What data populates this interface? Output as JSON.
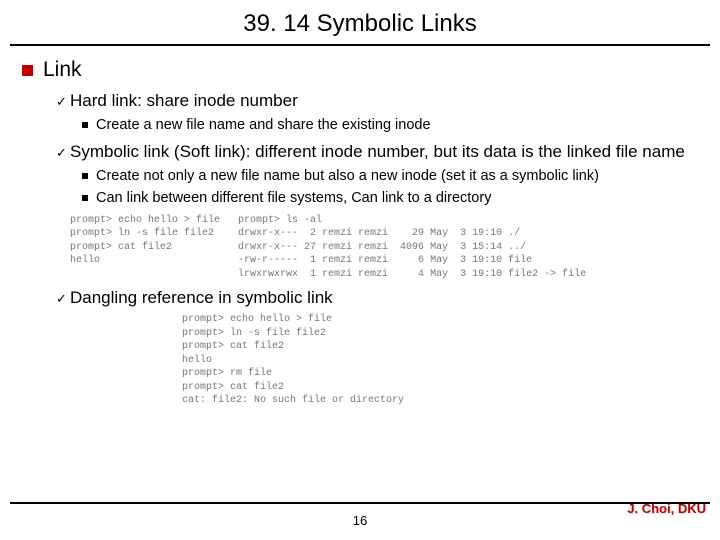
{
  "title": "39. 14 Symbolic Links",
  "section": "Link",
  "items": {
    "hard": {
      "heading": "Hard link: share inode number",
      "sub": [
        "Create a new file name and share the existing inode"
      ]
    },
    "soft": {
      "heading": "Symbolic link (Soft link): different inode number, but its data is the linked file name",
      "sub": [
        "Create not only a new file name but also a new inode (set it as a symbolic link)",
        "Can link between different file systems, Can link to a directory"
      ]
    },
    "dangling": {
      "heading": "Dangling reference in symbolic link"
    }
  },
  "code": {
    "left": "prompt> echo hello > file\nprompt> ln -s file file2\nprompt> cat file2\nhello",
    "right": "prompt> ls -al\ndrwxr-x---  2 remzi remzi    29 May  3 19:10 ./\ndrwxr-x--- 27 remzi remzi  4096 May  3 15:14 ../\n-rw-r-----  1 remzi remzi     6 May  3 19:10 file\nlrwxrwxrwx  1 remzi remzi     4 May  3 19:10 file2 -> file",
    "dangling": "prompt> echo hello > file\nprompt> ln -s file file2\nprompt> cat file2\nhello\nprompt> rm file\nprompt> cat file2\ncat: file2: No such file or directory"
  },
  "page": "16",
  "author": "J. Choi, DKU"
}
